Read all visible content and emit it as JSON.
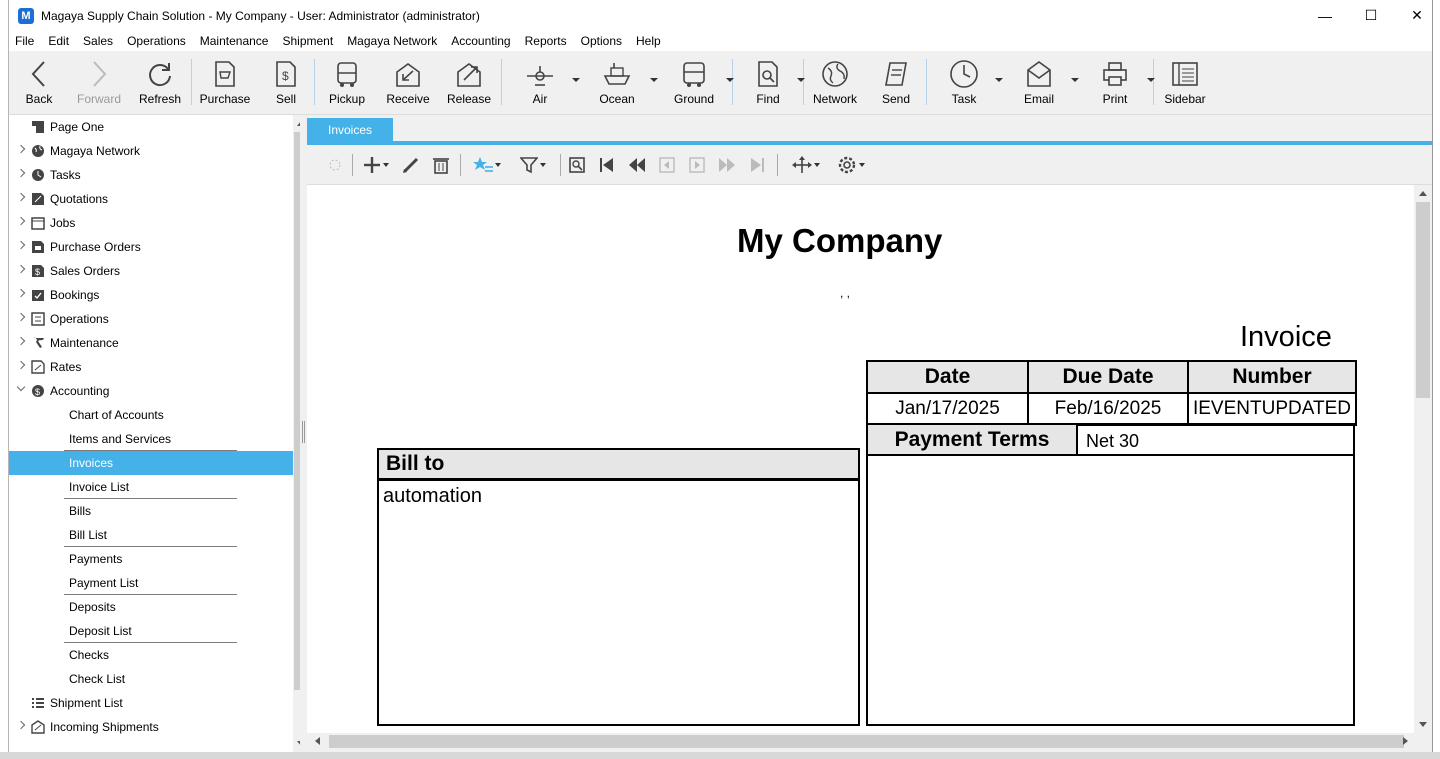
{
  "window": {
    "title": "Magaya Supply Chain Solution - My Company - User: Administrator (administrator)",
    "app_icon": "M",
    "minimize": "—",
    "maximize": "☐",
    "close": "✕"
  },
  "menu": [
    "File",
    "Edit",
    "Sales",
    "Operations",
    "Maintenance",
    "Shipment",
    "Magaya Network",
    "Accounting",
    "Reports",
    "Options",
    "Help"
  ],
  "toolbar": {
    "back": "Back",
    "forward": "Forward",
    "refresh": "Refresh",
    "purchase": "Purchase",
    "sell": "Sell",
    "pickup": "Pickup",
    "receive": "Receive",
    "release": "Release",
    "air": "Air",
    "ocean": "Ocean",
    "ground": "Ground",
    "find": "Find",
    "network": "Network",
    "send": "Send",
    "task": "Task",
    "email": "Email",
    "print": "Print",
    "sidebar": "Sidebar"
  },
  "sidebar": {
    "items": [
      {
        "label": "Page One",
        "icon": "page-one-icon"
      },
      {
        "label": "Magaya Network",
        "icon": "globe-icon"
      },
      {
        "label": "Tasks",
        "icon": "clock-icon"
      },
      {
        "label": "Quotations",
        "icon": "quotation-icon"
      },
      {
        "label": "Jobs",
        "icon": "jobs-icon"
      },
      {
        "label": "Purchase Orders",
        "icon": "purchase-order-icon"
      },
      {
        "label": "Sales Orders",
        "icon": "sales-order-icon"
      },
      {
        "label": "Bookings",
        "icon": "bookings-icon"
      },
      {
        "label": "Operations",
        "icon": "operations-icon"
      },
      {
        "label": "Maintenance",
        "icon": "wrench-icon"
      },
      {
        "label": "Rates",
        "icon": "rates-icon"
      },
      {
        "label": "Accounting",
        "icon": "dollar-icon"
      }
    ],
    "accounting_children": [
      "Chart of Accounts",
      "Items and Services",
      "Invoices",
      "Invoice List",
      "Bills",
      "Bill List",
      "Payments",
      "Payment List",
      "Deposits",
      "Deposit List",
      "Checks",
      "Check List"
    ],
    "bottom_items": [
      {
        "label": "Shipment List",
        "icon": "list-icon"
      },
      {
        "label": "Incoming Shipments",
        "icon": "incoming-icon"
      }
    ]
  },
  "tab": {
    "label": "Invoices"
  },
  "invoice": {
    "company": "My Company",
    "address": ", ,",
    "title": "Invoice",
    "date_label": "Date",
    "due_label": "Due Date",
    "number_label": "Number",
    "date": "Jan/17/2025",
    "due": "Feb/16/2025",
    "number": "IEVENTUPDATED",
    "terms_label": "Payment Terms",
    "terms": "Net 30",
    "billto_label": "Bill to",
    "billto": "automation"
  },
  "colors": {
    "accent": "#44b2e8"
  }
}
